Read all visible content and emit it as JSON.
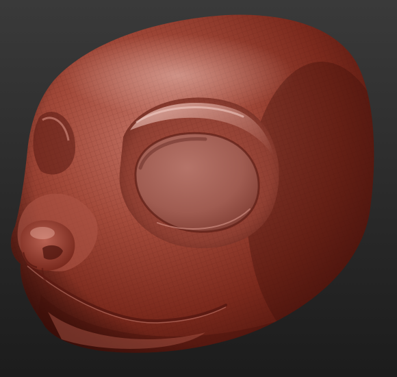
{
  "scene": {
    "subject": "sculpted-head-model",
    "colors": {
      "background_top": "#3a3a3a",
      "background_bottom": "#1c1c1c",
      "clay_light": "#c8776b",
      "clay_mid": "#9a3e2e",
      "clay_dark": "#4a120b",
      "wire": "#5a1a12"
    }
  }
}
